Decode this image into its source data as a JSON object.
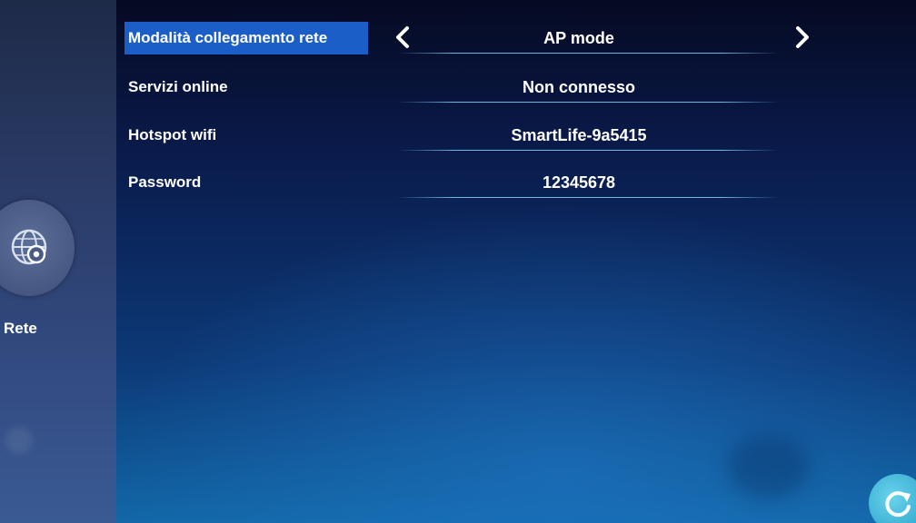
{
  "sidebar": {
    "icon": "globe-gear-icon",
    "label": "Rete"
  },
  "settings": {
    "rows": [
      {
        "label": "Modalità collegamento rete",
        "value": "AP mode",
        "selected": true
      },
      {
        "label": "Servizi online",
        "value": "Non connesso"
      },
      {
        "label": "Hotspot wifi",
        "value": "SmartLife-9a5415"
      },
      {
        "label": "Password",
        "value": "12345678"
      }
    ]
  },
  "controls": {
    "prev_icon": "chevron-left-icon",
    "next_icon": "chevron-right-icon",
    "corner_button_icon": "refresh-icon"
  },
  "colors": {
    "selected_bg": "#1c5ec8",
    "accent": "#3aaed2",
    "divider": "#78c8f0"
  }
}
